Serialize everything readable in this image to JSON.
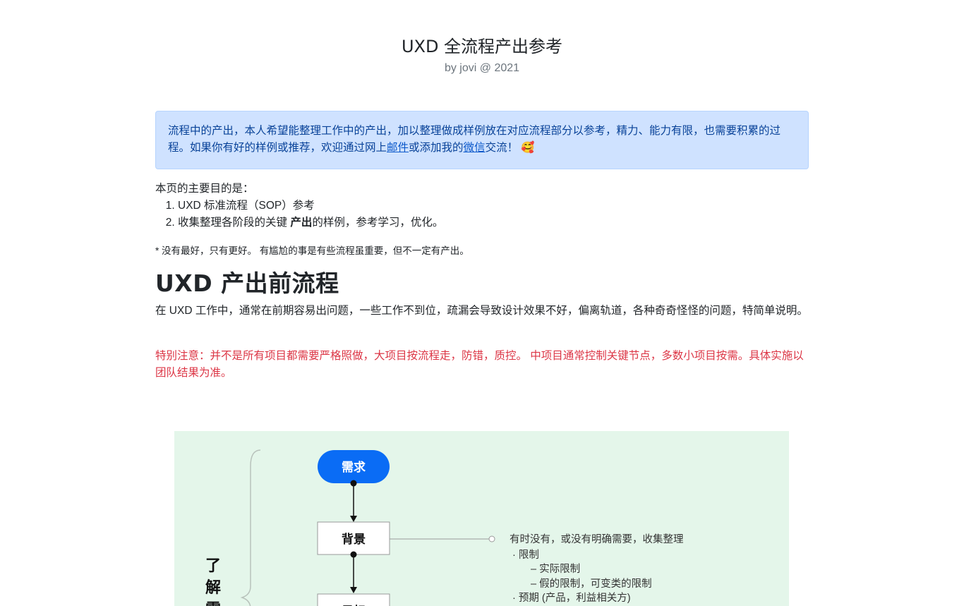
{
  "header": {
    "title": "UXD 全流程产出参考",
    "byline": "by jovi @ 2021"
  },
  "alert": {
    "text_part1": "流程中的产出，本人希望能整理工作中的产出，加以整理做成样例放在对应流程部分以参考，精力、能力有限，也需要积累的过程。如果你有好的样例或推荐，欢迎通过网上",
    "mail_link": "邮件",
    "text_part2": "或添加我的",
    "wechat_link": "微信",
    "text_part3": "交流！",
    "emoji": "🥰"
  },
  "intro": {
    "lead": "本页的主要目的是：",
    "items": [
      {
        "text": "UXD 标准流程（SOP）参考"
      },
      {
        "prefix": "收集整理各阶段的关键 ",
        "bold": "产出",
        "suffix": "的样例，参考学习，优化。"
      }
    ]
  },
  "note": "* 没有最好，只有更好。 有尴尬的事是有些流程虽重要，但不一定有产出。",
  "section": {
    "heading": "UXD 产出前流程",
    "paragraph": "在 UXD 工作中，通常在前期容易出问题，一些工作不到位，疏漏会导致设计效果不好，偏离轨道，各种奇奇怪怪的问题，特简单说明。",
    "warning": "特别注意：并不是所有项目都需要严格照做，大项目按流程走，防错，质控。 中项目通常控制关键节点，多数小项目按需。具体实施以团队结果为准。"
  },
  "diagram": {
    "node_start": "需求",
    "node_background": "背景",
    "node_next": "目标",
    "side_label": [
      "了",
      "解",
      "需"
    ],
    "notes": [
      "有时没有，或没有明确需要，收集整理",
      "· 限制",
      "– 实际限制",
      "– 假的限制，可变类的限制",
      "· 预期 (产品，利益相关方)"
    ],
    "colors": {
      "background": "#e4f6ea",
      "start_node": "#0a6cf5",
      "box_border": "#999999",
      "line": "#111111",
      "connector": "#9a9a9a"
    }
  }
}
